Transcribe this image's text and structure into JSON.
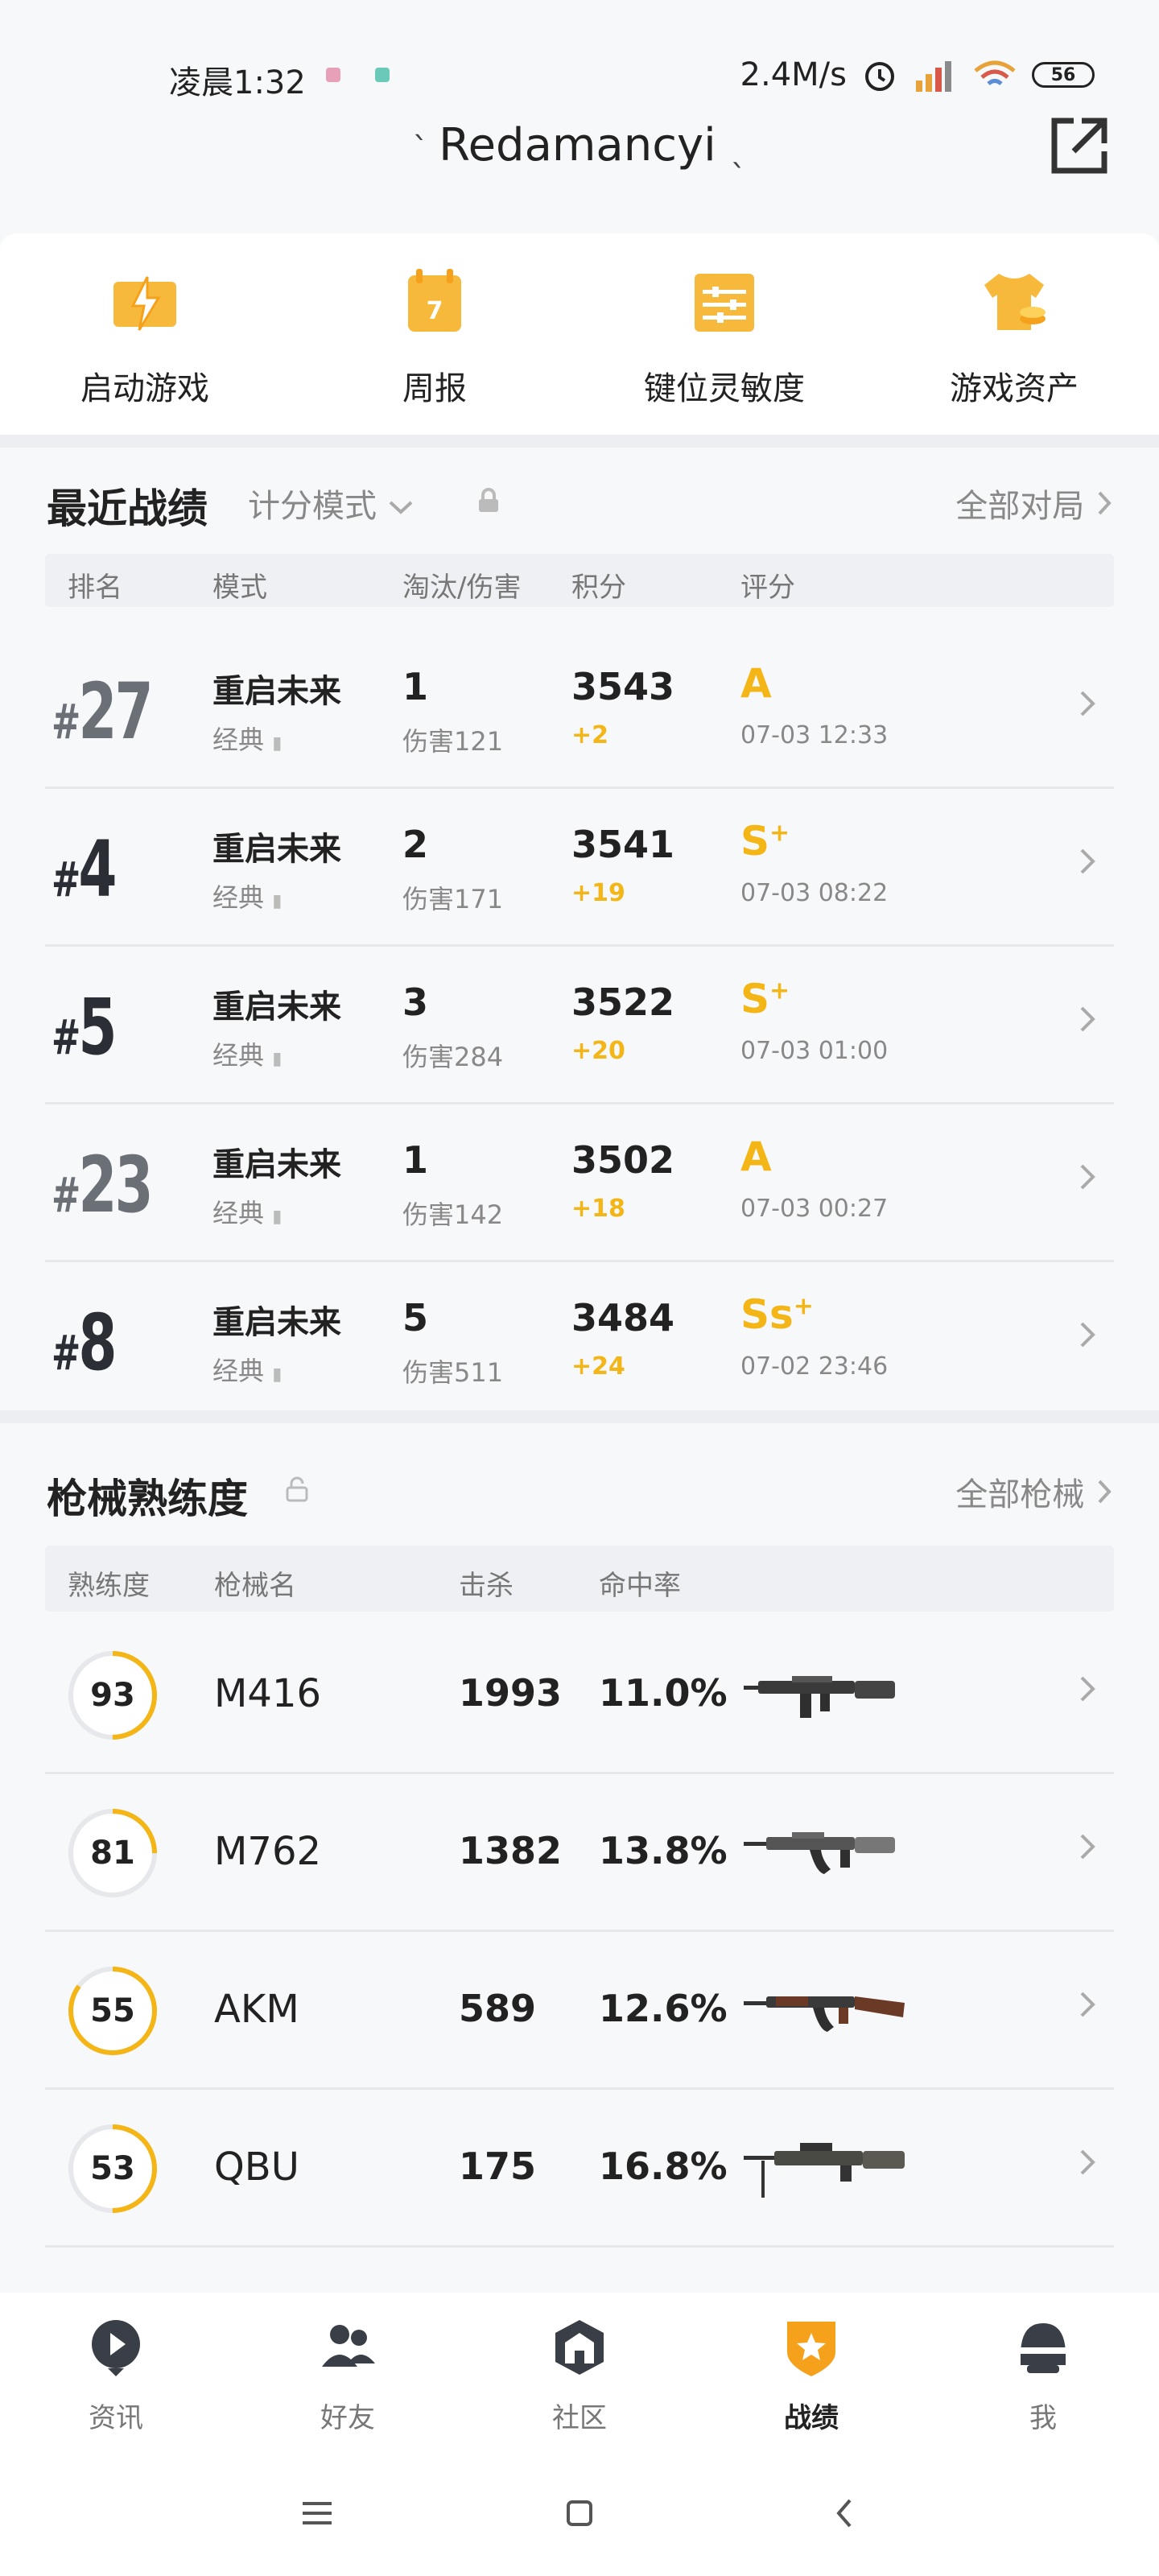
{
  "status_bar": {
    "time": "凌晨1:32",
    "network_speed": "2.4M/s",
    "battery": "56"
  },
  "header": {
    "title": "Redamancyi"
  },
  "quick_actions": [
    {
      "label": "启动游戏",
      "icon": "lightning-icon"
    },
    {
      "label": "周报",
      "icon": "calendar-icon"
    },
    {
      "label": "键位灵敏度",
      "icon": "sliders-icon"
    },
    {
      "label": "游戏资产",
      "icon": "shirt-coins-icon"
    }
  ],
  "recent": {
    "title": "最近战绩",
    "mode_filter": "计分模式",
    "more_label": "全部对局",
    "columns": [
      "排名",
      "模式",
      "淘汰/伤害",
      "积分",
      "评分"
    ],
    "rows": [
      {
        "rank": "27",
        "mode": "重启未来",
        "sub": "经典",
        "kills": "1",
        "damage": "伤害121",
        "score": "3543",
        "delta": "+2",
        "grade": "A",
        "grade_sup": "",
        "date": "07-03 12:33",
        "rank_color": "#6b6f76"
      },
      {
        "rank": "4",
        "mode": "重启未来",
        "sub": "经典",
        "kills": "2",
        "damage": "伤害171",
        "score": "3541",
        "delta": "+19",
        "grade": "S",
        "grade_sup": "+",
        "date": "07-03 08:22",
        "rank_color": "#2b2f35"
      },
      {
        "rank": "5",
        "mode": "重启未来",
        "sub": "经典",
        "kills": "3",
        "damage": "伤害284",
        "score": "3522",
        "delta": "+20",
        "grade": "S",
        "grade_sup": "+",
        "date": "07-03 01:00",
        "rank_color": "#2b2f35"
      },
      {
        "rank": "23",
        "mode": "重启未来",
        "sub": "经典",
        "kills": "1",
        "damage": "伤害142",
        "score": "3502",
        "delta": "+18",
        "grade": "A",
        "grade_sup": "",
        "date": "07-03 00:27",
        "rank_color": "#6b6f76"
      },
      {
        "rank": "8",
        "mode": "重启未来",
        "sub": "经典",
        "kills": "5",
        "damage": "伤害511",
        "score": "3484",
        "delta": "+24",
        "grade": "Ss",
        "grade_sup": "+",
        "date": "07-02 23:46",
        "rank_color": "#2b2f35"
      }
    ]
  },
  "weapons": {
    "title": "枪械熟练度",
    "more_label": "全部枪械",
    "columns": [
      "熟练度",
      "枪械名",
      "击杀",
      "命中率"
    ],
    "rows": [
      {
        "mastery": "93",
        "progress": 0.5,
        "name": "M416",
        "kills": "1993",
        "accuracy": "11.0%"
      },
      {
        "mastery": "81",
        "progress": 0.25,
        "name": "M762",
        "kills": "1382",
        "accuracy": "13.8%"
      },
      {
        "mastery": "55",
        "progress": 0.85,
        "name": "AKM",
        "kills": "589",
        "accuracy": "12.6%"
      },
      {
        "mastery": "53",
        "progress": 0.5,
        "name": "QBU",
        "kills": "175",
        "accuracy": "16.8%"
      }
    ]
  },
  "bottom_nav": [
    {
      "label": "资讯",
      "active": false
    },
    {
      "label": "好友",
      "active": false
    },
    {
      "label": "社区",
      "active": false
    },
    {
      "label": "战绩",
      "active": true
    },
    {
      "label": "我",
      "active": false
    }
  ],
  "colors": {
    "accent": "#f4b516",
    "text": "#222222",
    "muted": "#888888"
  }
}
